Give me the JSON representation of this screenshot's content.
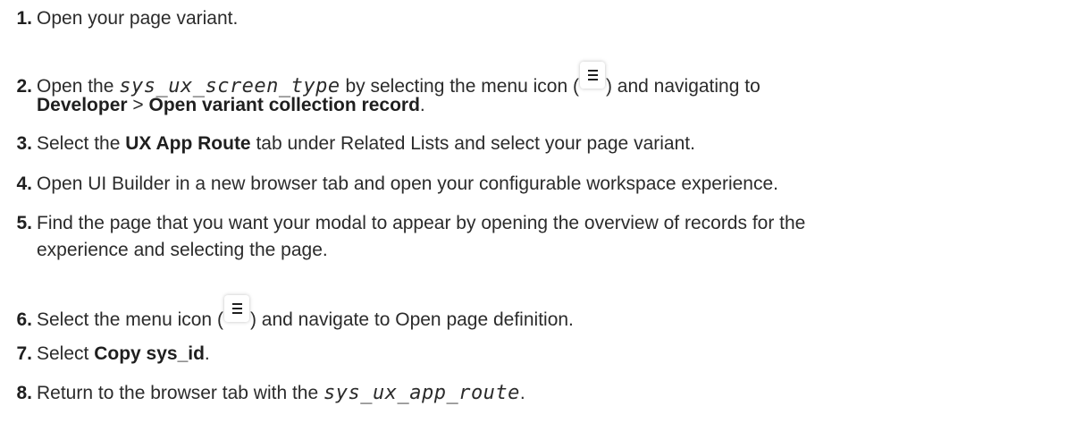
{
  "steps": [
    {
      "num": "1.",
      "t1": "Open your page variant."
    },
    {
      "num": "2.",
      "t1": "Open the ",
      "code1": "sys_ux_screen_type",
      "t2": " by selecting the menu icon (",
      "icon": "menu-icon",
      "t3": ") and navigating to",
      "b1": "Developer",
      "t4": " > ",
      "b2": "Open variant collection record",
      "t5": "."
    },
    {
      "num": "3.",
      "t1": "Select the ",
      "b1": "UX App Route",
      "t2": " tab under Related Lists and select your page variant."
    },
    {
      "num": "4.",
      "t1": "Open UI Builder in a new browser tab and open your configurable workspace experience."
    },
    {
      "num": "5.",
      "t1": "Find the page that you want your modal to appear by opening the overview of records for the",
      "t2": "experience and selecting the page."
    },
    {
      "num": "6.",
      "t1": "Select the menu icon (",
      "icon": "menu-icon",
      "t2": ") and navigate to Open page definition."
    },
    {
      "num": "7.",
      "t1": "Select ",
      "b1": "Copy sys_id",
      "t2": "."
    },
    {
      "num": "8.",
      "t1": "Return to the browser tab with the ",
      "code1": "sys_ux_app_route",
      "t2": "."
    }
  ]
}
